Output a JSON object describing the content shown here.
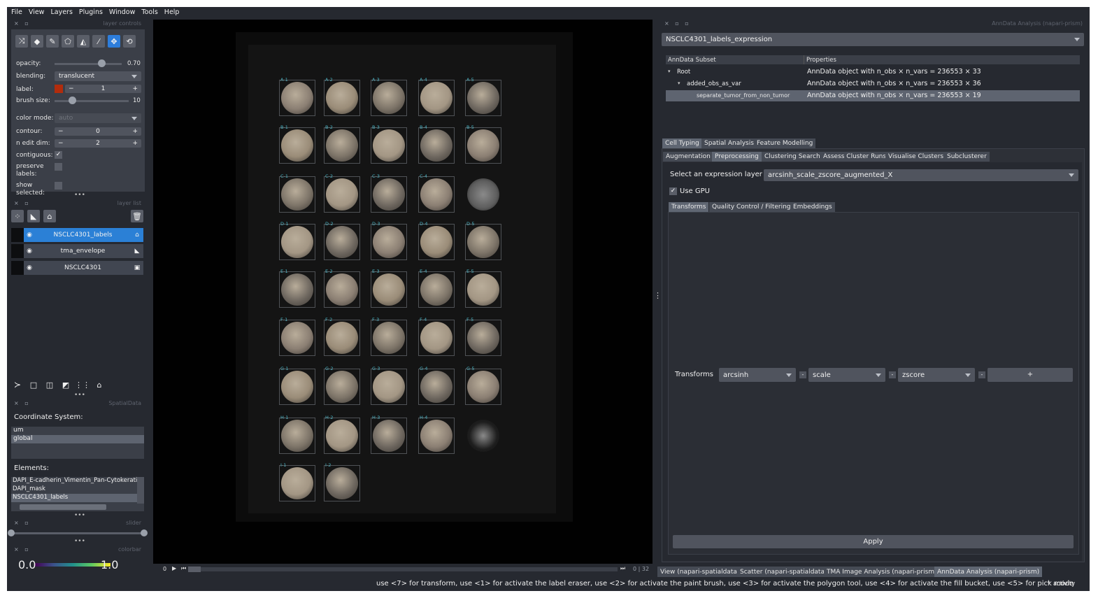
{
  "menu": [
    "File",
    "View",
    "Layers",
    "Plugins",
    "Window",
    "Tools",
    "Help"
  ],
  "layer_controls": {
    "title": "layer controls",
    "opacity_label": "opacity:",
    "opacity_value": "0.70",
    "opacity_fraction": 0.7,
    "blending_label": "blending:",
    "blending_value": "translucent",
    "label_label": "label:",
    "label_value": "1",
    "label_color": "#b22c0c",
    "brush_label": "brush size:",
    "brush_value": "10",
    "color_mode_label": "color mode:",
    "color_mode_value": "auto",
    "contour_label": "contour:",
    "contour_value": "0",
    "nedit_label": "n edit dim:",
    "nedit_value": "2",
    "contiguous_label": "contiguous:",
    "preserve_label": "preserve labels:",
    "show_selected_label": "show selected:"
  },
  "layer_list": {
    "title": "layer list",
    "layers": [
      {
        "name": "NSCLC4301_labels",
        "selected": true,
        "icon": "label-layer-icon"
      },
      {
        "name": "tma_envelope",
        "selected": false,
        "icon": "shapes-layer-icon"
      },
      {
        "name": "NSCLC4301",
        "selected": false,
        "icon": "image-layer-icon"
      }
    ]
  },
  "spatialdata": {
    "title": "SpatialData",
    "coord_label": "Coordinate System:",
    "coords": [
      "um",
      "global"
    ],
    "elements_label": "Elements:",
    "elements": [
      "DAPI_E-cadherin_Vimentin_Pan-Cytokerati",
      "DAPI_mask",
      "NSCLC4301_labels"
    ]
  },
  "slider": {
    "title": "slider"
  },
  "colorbar": {
    "title": "colorbar",
    "min": "0.0",
    "max": "1.0"
  },
  "canvas": {
    "rows": [
      "A",
      "B",
      "C",
      "D",
      "E",
      "F",
      "G",
      "H",
      "I"
    ],
    "labels": [
      [
        "A-1",
        "A-2",
        "A-3",
        "A-4",
        "A-5"
      ],
      [
        "B-1",
        "B-2",
        "B-3",
        "B-4",
        "B-5"
      ],
      [
        "C-1",
        "C-2",
        "C-3",
        "C-4",
        ""
      ],
      [
        "D-1",
        "D-2",
        "D-3",
        "D-4",
        "D-5"
      ],
      [
        "E-1",
        "E-2",
        "E-3",
        "E-4",
        "E-5"
      ],
      [
        "F-1",
        "F-2",
        "F-3",
        "F-4",
        "F-5"
      ],
      [
        "G-1",
        "G-2",
        "G-3",
        "G-4",
        "G-5"
      ],
      [
        "H-1",
        "H-2",
        "H-3",
        "H-4",
        ""
      ],
      [
        "I-1",
        "I-2",
        "",
        "",
        ""
      ]
    ],
    "dim_start": "0",
    "dim_info": "0 | 32"
  },
  "anndata": {
    "title": "AnnData Analysis (napari-prism)",
    "layer_select": "NSCLC4301_labels_expression",
    "tree_headers": [
      "AnnData Subset",
      "Properties"
    ],
    "tree": [
      {
        "name": "Root",
        "props": "AnnData object with n_obs × n_vars = 236553 × 33",
        "selected": false
      },
      {
        "name": "added_obs_as_var",
        "props": "AnnData object with n_obs × n_vars = 236553 × 36",
        "selected": false
      },
      {
        "name": "separate_tumor_from_non_tumor",
        "props": "AnnData object with n_obs × n_vars = 236553 × 19",
        "selected": true
      }
    ],
    "main_tabs": [
      "Cell Typing",
      "Spatial Analysis",
      "Feature Modelling"
    ],
    "sub_tabs": [
      "Augmentation",
      "Preprocessing",
      "Clustering Search",
      "Assess Cluster Runs",
      "Visualise Clusters",
      "Subclusterer"
    ],
    "expr_label": "Select an expression layer",
    "expr_value": "arcsinh_scale_zscore_augmented_X",
    "gpu_label": "Use GPU",
    "inner_tabs": [
      "Transforms",
      "Quality Control / Filtering",
      "Embeddings"
    ],
    "transforms_label": "Transforms",
    "transforms": [
      "arcsinh",
      "scale",
      "zscore"
    ],
    "remove_label": "-",
    "add_label": "+",
    "apply_label": "Apply"
  },
  "bottom_tabs": [
    "View (napari-spatialdata)",
    "Scatter (napari-spatialdata)",
    "TMA Image Analysis (napari-prism)",
    "AnnData Analysis (napari-prism)"
  ],
  "status": {
    "text": "use <7> for transform, use <1> for activate the label eraser, use <2> for activate the paint brush, use <3> for activate the polygon tool, use <4> for activate the fill bucket, use <5> for pick mode",
    "activity": "activity"
  }
}
